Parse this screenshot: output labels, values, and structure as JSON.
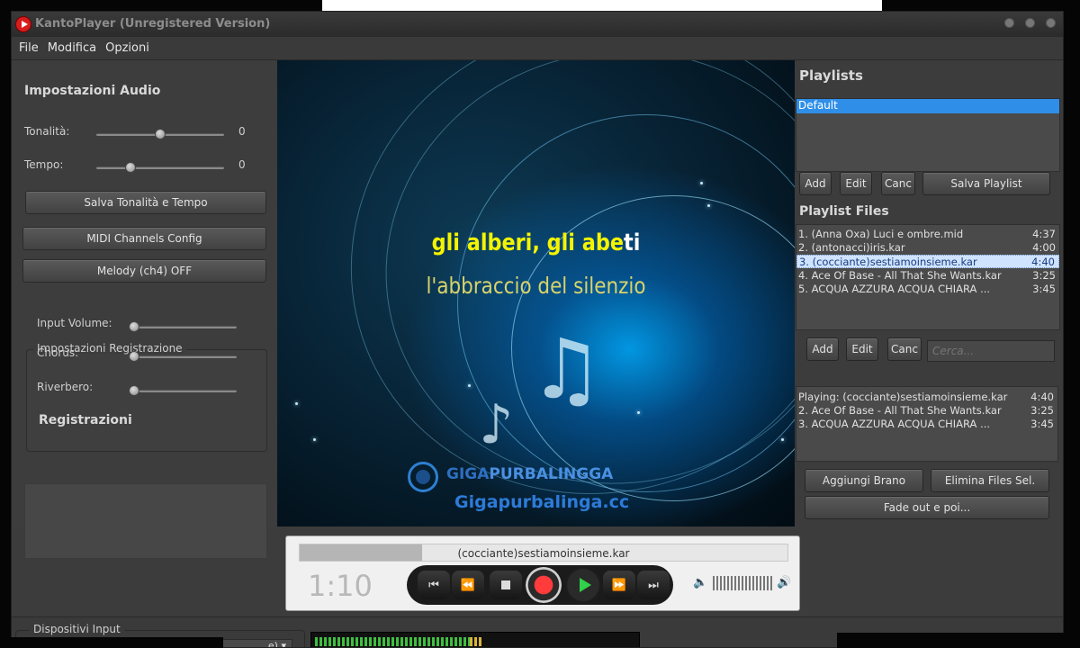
{
  "window": {
    "title": "KantoPlayer (Unregistered Version)"
  },
  "menu": [
    "File",
    "Modifica",
    "Opzioni"
  ],
  "audio": {
    "title": "Impostazioni Audio",
    "tonalita_label": "Tonalità:",
    "tonalita_value": "0",
    "tonalita_level": 0.5,
    "tempo_label": "Tempo:",
    "tempo_value": "0",
    "tempo_level": 0.27,
    "save_button": "Salva Tonalità e Tempo",
    "midi_button": "MIDI Channels Config",
    "melody_button": "Melody (ch4) OFF"
  },
  "recording": {
    "title": "Impostazioni Registrazione",
    "input_volume_label": "Input Volume:",
    "chorus_label": "Chorus:",
    "riverbero_label": "Riverbero:",
    "registrazioni_title": "Registrazioni"
  },
  "lyrics": {
    "line1_sung": "gli alberi, gli abe",
    "line1_rest": "ti",
    "line2": "l'abbraccio del silenzio"
  },
  "watermark": {
    "brand_a": "GIGA",
    "brand_b": "PURBALINGGA",
    "site": "Gigapurbalinga.cc"
  },
  "playlists": {
    "title": "Playlists",
    "items": [
      "Default"
    ],
    "add": "Add",
    "edit": "Edit",
    "canc": "Canc",
    "save": "Salva Playlist"
  },
  "playlist_files": {
    "title": "Playlist Files",
    "items": [
      {
        "name": "1. (Anna Oxa) Luci e ombre.mid",
        "duration": "4:37"
      },
      {
        "name": "2. (antonacci)iris.kar",
        "duration": "4:00"
      },
      {
        "name": "3. (cocciante)sestiamoinsieme.kar",
        "duration": "4:40"
      },
      {
        "name": "4. Ace Of Base - All That She Wants.kar",
        "duration": "3:25"
      },
      {
        "name": "5. ACQUA AZZURA ACQUA CHIARA       ...",
        "duration": "3:45"
      }
    ],
    "add": "Add",
    "edit": "Edit",
    "canc": "Canc",
    "search_placeholder": "Cerca..."
  },
  "queue": {
    "items": [
      {
        "name": "Playing: (cocciante)sestiamoinsieme.kar",
        "duration": "4:40"
      },
      {
        "name": "2. Ace Of Base - All That She Wants.kar",
        "duration": "3:25"
      },
      {
        "name": "3. ACQUA AZZURA ACQUA CHIARA       ...",
        "duration": "3:45"
      }
    ],
    "add_song": "Aggiungi Brano",
    "remove_selected": "Elimina Files Sel.",
    "fade_out": "Fade out e poi..."
  },
  "player": {
    "track": "(cocciante)sestiamoinsieme.kar",
    "time": "1:10",
    "progress": 0.25
  },
  "devices": {
    "title": "Dispositivi Input",
    "select_value": "e)",
    "meter_level": 0.52
  },
  "colors": {
    "accent_blue": "#2f8fe8",
    "lyric_yellow": "#f4f400",
    "record_red": "#e01b1b",
    "play_green": "#32d04a"
  }
}
